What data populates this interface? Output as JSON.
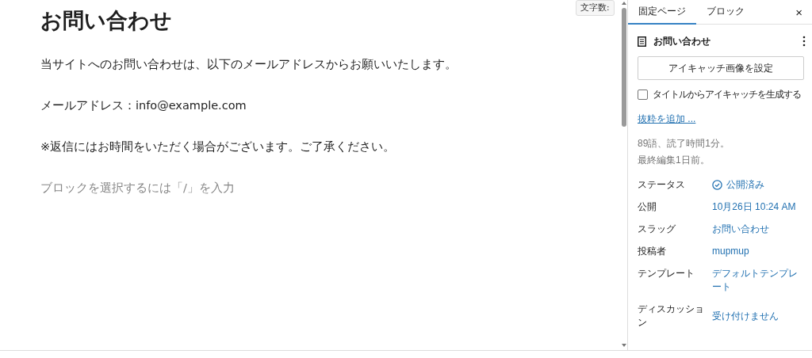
{
  "editor": {
    "word_count_button": "文字数:",
    "title": "お問い合わせ",
    "paragraphs": [
      {
        "text": "当サイトへのお問い合わせは、以下のメールアドレスからお願いいたします。"
      },
      {
        "text": "メールアドレス：info@example.com"
      },
      {
        "text": "※返信にはお時間をいただく場合がございます。ご了承ください。"
      }
    ],
    "block_placeholder": "ブロックを選択するには「/」を入力"
  },
  "sidebar": {
    "tabs": [
      {
        "label": "固定ページ",
        "selected": true
      },
      {
        "label": "ブロック",
        "selected": false
      }
    ],
    "close": "×",
    "page_title": "お問い合わせ",
    "featured_image_button": "アイキャッチ画像を設定",
    "generate_checkbox": {
      "label": "タイトルからアイキャッチを生成する",
      "checked": false
    },
    "excerpt_link": "抜粋を追加 ...",
    "stats": "89語、読了時間1分。",
    "last_edited": "最終編集1日前。",
    "fields": [
      {
        "label": "ステータス",
        "value": "公開済み",
        "kind": "status"
      },
      {
        "label": "公開",
        "value": "10月26日 10:24 AM",
        "kind": "link"
      },
      {
        "label": "スラッグ",
        "value": "お問い合わせ",
        "kind": "link"
      },
      {
        "label": "投稿者",
        "value": "mupmup",
        "kind": "link"
      },
      {
        "label": "テンプレート",
        "value": "デフォルトテンプレート",
        "kind": "link"
      },
      {
        "label": "ディスカッション",
        "value": "受け付けません",
        "kind": "link"
      }
    ]
  }
}
